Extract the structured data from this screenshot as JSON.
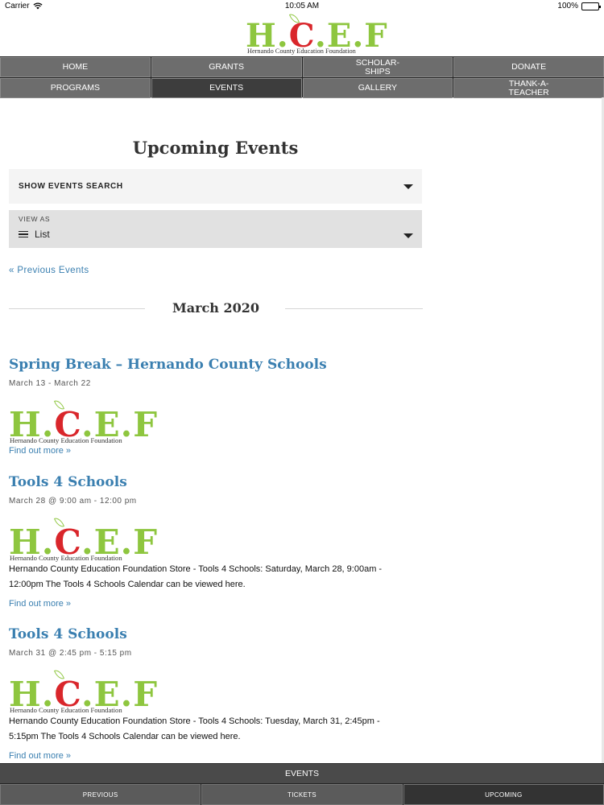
{
  "status_bar": {
    "carrier": "Carrier",
    "time": "10:05 AM",
    "battery": "100%",
    "battery_level": 1.0
  },
  "logo": {
    "letters": [
      "H",
      ".",
      "C",
      ".",
      "E",
      ".",
      "F"
    ],
    "tagline": "Hernando County Education Foundation"
  },
  "nav": {
    "items": [
      {
        "label": "HOME"
      },
      {
        "label": "GRANTS"
      },
      {
        "label": "SCHOLAR-\nSHIPS"
      },
      {
        "label": "DONATE"
      },
      {
        "label": "PROGRAMS"
      },
      {
        "label": "EVENTS",
        "active": true
      },
      {
        "label": "GALLERY"
      },
      {
        "label": "THANK-A-\nTEACHER"
      }
    ]
  },
  "main": {
    "title": "Upcoming Events",
    "events_search_label": "SHOW EVENTS SEARCH",
    "view_as_label": "VIEW AS",
    "view_as_value": "List",
    "previous_events": "« Previous Events",
    "month": "March 2020",
    "events": [
      {
        "title": "Spring Break – Hernando County Schools",
        "date": "March 13 - March 22",
        "description": "",
        "more": "Find out more »"
      },
      {
        "title": "Tools 4 Schools",
        "date": "March 28 @ 9:00 am - 12:00 pm",
        "description": "Hernando County Education Foundation Store - Tools 4 Schools: Saturday, March 28, 9:00am - 12:00pm The Tools 4 Schools Calendar can be viewed here.",
        "more": "Find out more »"
      },
      {
        "title": "Tools 4 Schools",
        "date": "March 31 @ 2:45 pm - 5:15 pm",
        "description": "Hernando County Education Foundation Store - Tools 4 Schools: Tuesday, March 31, 2:45pm - 5:15pm The Tools 4 Schools Calendar can be viewed here.",
        "more": "Find out more »"
      }
    ]
  },
  "bottom_bar": {
    "title": "EVENTS",
    "tabs": [
      {
        "label": "PREVIOUS"
      },
      {
        "label": "TICKETS"
      },
      {
        "label": "UPCOMING",
        "active": true
      }
    ]
  },
  "colors": {
    "brand_green": "#8ec63f",
    "brand_red": "#d9262b",
    "link_blue": "#3a7fb0",
    "nav_gray": "#6d6d6d"
  }
}
